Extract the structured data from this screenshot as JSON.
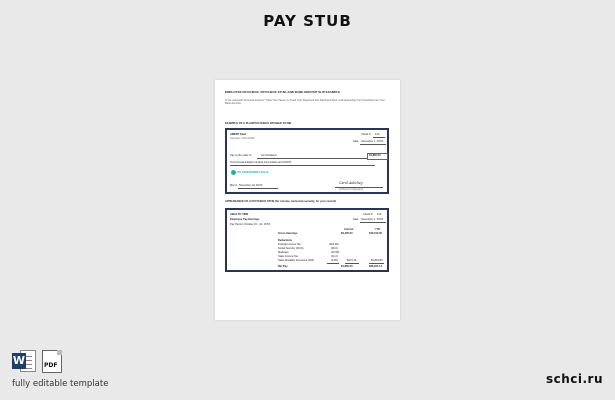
{
  "header": {
    "title": "PAY STUB"
  },
  "document": {
    "heading": "EMPLOYEE PAYCHECK, PAYCHECK STUB, AND BANK DEPOSIT SLIP EXAMPLE",
    "intro": "To be used with Personal Finance \"Track Your Taxes\" to Track Your Paycheck and Paycheck Stub, and Depositing Your Paycheck into Your Bank Account",
    "check_section": "EXAMPLE OF A PLAIN PAYCHECK PAYABLE TO ME",
    "check": {
      "company": "AMENT Steel",
      "company_addr": "Anytown, USA 12345",
      "check_no_label": "Check #",
      "check_no": "123",
      "date_label": "Date",
      "date": "November 1, 2XXX",
      "pay_to_label": "Pay to the order of",
      "payee": "Ann Rowland",
      "amount": "$1,860.00",
      "amount_words": "One thousand Eight hundred sixty dollars and 00/100",
      "bank_name": "US FIREWORKS Bank",
      "memo_label": "Memo",
      "memo": "November 1st 2XXX",
      "signature": "Carol Aulichey",
      "signature_label": "Authorized Signature"
    },
    "stub_section": "APPEARANCE OF A PAYCHECK STUB (for income, tax/social security, for your record)",
    "stub": {
      "company": "ABLE PC TIME",
      "subtitle": "Employee Pay Earnings",
      "period": "Pay Period: October 16 - 31, 2XXX",
      "check_no_label": "Check #",
      "check_no": "123",
      "date_label": "Date",
      "date": "November 1, 2XXX",
      "col_current": "Current",
      "col_ytd": "YTD",
      "gross_label": "Gross Earnings",
      "gross_current": "$2,400.00",
      "gross_ytd": "$40,100.00",
      "deductions_label": "Deductions",
      "rows": [
        {
          "label": "Federal Income Tax",
          "current": "(264.00)",
          "ytd": ""
        },
        {
          "label": "Social Security (FICA)",
          "current": "(90.0)",
          "ytd": ""
        },
        {
          "label": "Medicare",
          "current": "(34.50)",
          "ytd": ""
        },
        {
          "label": "State Income Tax",
          "current": "(41.0)",
          "ytd": ""
        },
        {
          "label": "State Disability Insurance (SDI)",
          "current": "(6.00)",
          "ytd": "$273.14"
        }
      ],
      "total_ded_ytd": "$2,894.86",
      "net_label": "Net Pay",
      "net_current": "$1,860.00",
      "net_ytd": "$36,205.14"
    }
  },
  "footer": {
    "word_icon_letter": "W",
    "pdf_icon_label": "PDF",
    "caption": "fully editable template",
    "brand": "schci.ru"
  }
}
